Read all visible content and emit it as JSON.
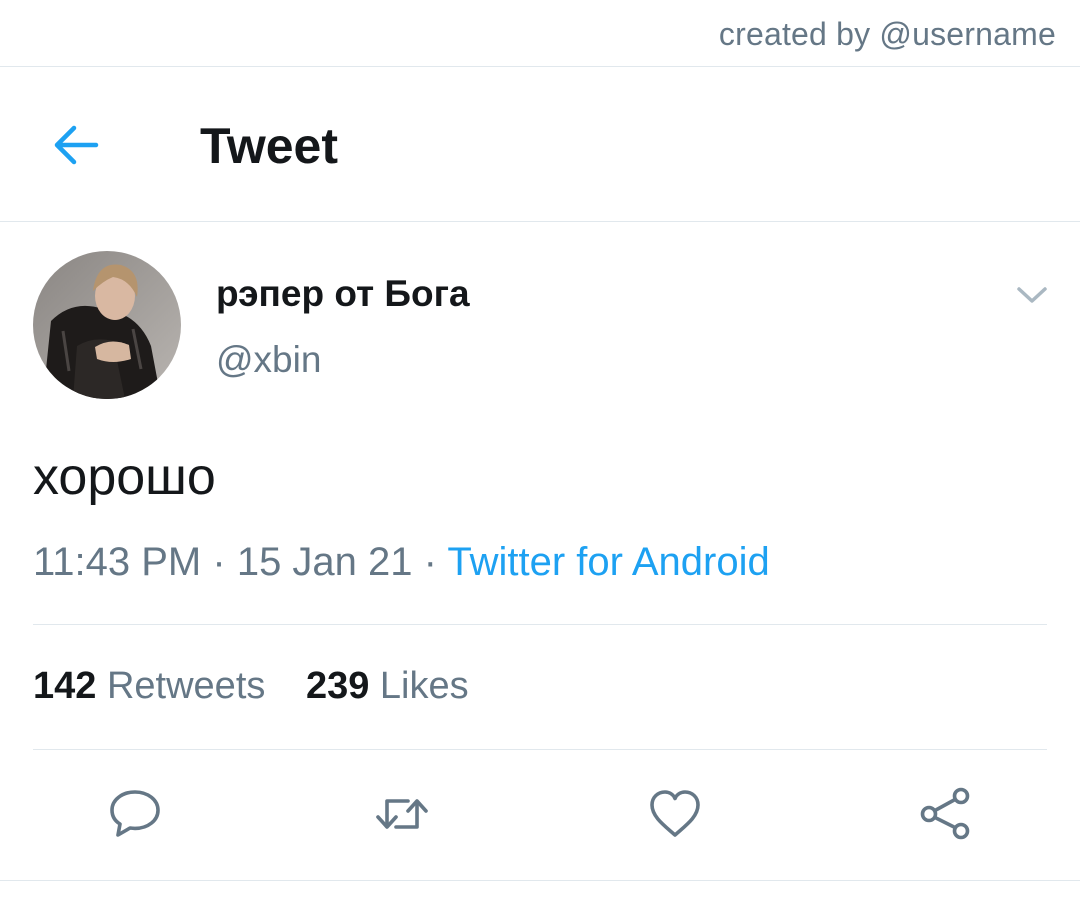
{
  "credit": "created by @username",
  "header": {
    "back_icon": "arrow-left-icon",
    "title": "Tweet"
  },
  "tweet": {
    "author": {
      "display_name": "рэпер от Бога",
      "handle": "@xbin"
    },
    "caret_icon": "chevron-down-icon",
    "text": "хорошо",
    "time": "11:43 PM",
    "separator": "·",
    "date": "15 Jan 21",
    "source": "Twitter for Android",
    "stats": {
      "retweets_count": "142",
      "retweets_label": "Retweets",
      "likes_count": "239",
      "likes_label": "Likes"
    },
    "actions": [
      {
        "name": "reply",
        "icon": "speech-bubble-icon"
      },
      {
        "name": "retweet",
        "icon": "retweet-icon"
      },
      {
        "name": "like",
        "icon": "heart-icon"
      },
      {
        "name": "share",
        "icon": "share-icon"
      }
    ]
  },
  "colors": {
    "accent": "#1da1f2",
    "text_primary": "#14171a",
    "text_secondary": "#657786",
    "divider": "#e1e8ed"
  }
}
